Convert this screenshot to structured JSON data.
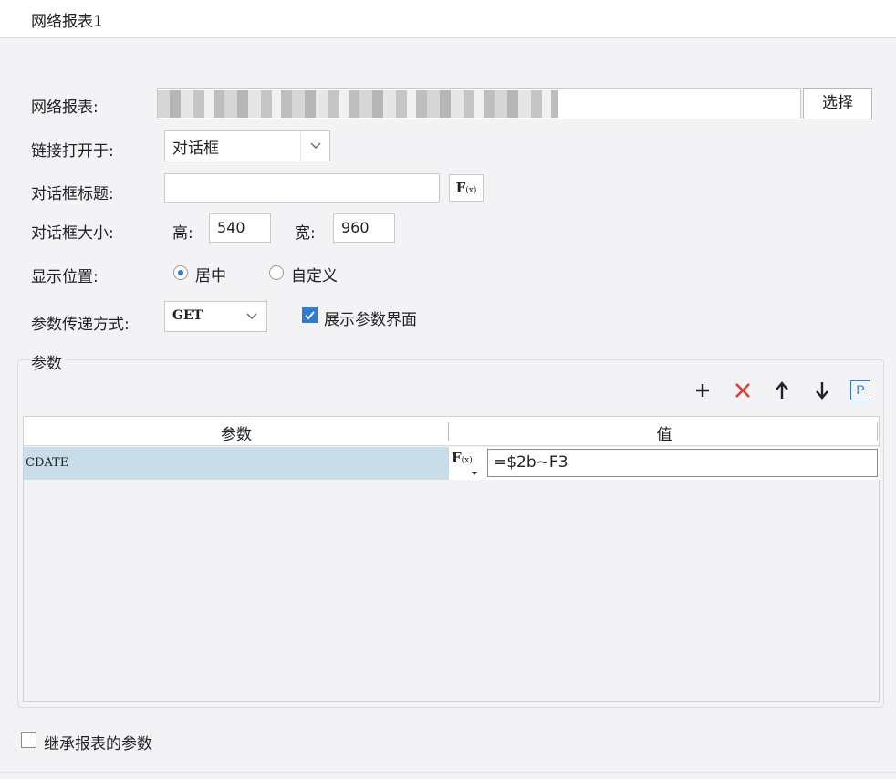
{
  "window": {
    "title": "网络报表1"
  },
  "form": {
    "report_label": "网络报表:",
    "select_button": "选择",
    "open_in_label": "链接打开于:",
    "open_in_value": "对话框",
    "dialog_title_label": "对话框标题:",
    "dialog_title_value": "",
    "fx_label": "F",
    "fx_sub": "(x)",
    "dialog_size_label": "对话框大小:",
    "height_label": "高:",
    "height_value": "540",
    "width_label": "宽:",
    "width_value": "960",
    "position_label": "显示位置:",
    "position_options": [
      "居中",
      "自定义"
    ],
    "position_selected": "居中",
    "param_method_label": "参数传递方式:",
    "param_method_value": "GET",
    "show_param_panel_label": "展示参数界面",
    "show_param_panel_checked": true
  },
  "params": {
    "group_label": "参数",
    "toolbar": [
      "add-icon",
      "delete-icon",
      "move-up-icon",
      "move-down-icon",
      "param-p-icon"
    ],
    "toolbar_p": "P",
    "columns": [
      "参数",
      "值"
    ],
    "rows": [
      {
        "name": "CDATE",
        "value": "=$2b~F3"
      }
    ]
  },
  "inherit": {
    "label": "继承报表的参数",
    "checked": false
  },
  "colors": {
    "accent": "#2f7bd6",
    "delete": "#e53935",
    "row_selected": "#c9dcea"
  }
}
